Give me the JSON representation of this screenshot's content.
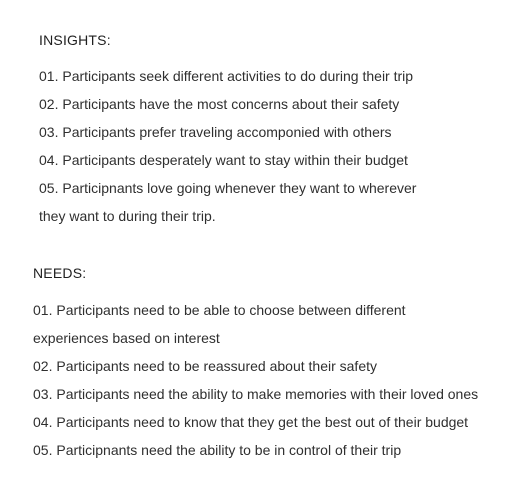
{
  "insights": {
    "title": "INSIGHTS:",
    "lines": [
      "01. Participants seek different activities to do during their trip",
      "02. Participants have the most concerns about their safety",
      "03. Participants prefer traveling accomponied with others",
      "04. Participants desperately want to stay within their budget",
      "05. Participnants love going whenever they want to wherever",
      "they want to during their trip."
    ]
  },
  "needs": {
    "title": "NEEDS:",
    "lines": [
      "01. Participants need to be able to choose between different",
      "experiences based on interest",
      "02. Participants need to be reassured about their safety",
      "03. Participants  need the ability to make memories with their loved ones",
      "04. Participants need to know that they get the best out of their budget",
      "05. Participnants need the ability to be in control of their trip"
    ]
  }
}
